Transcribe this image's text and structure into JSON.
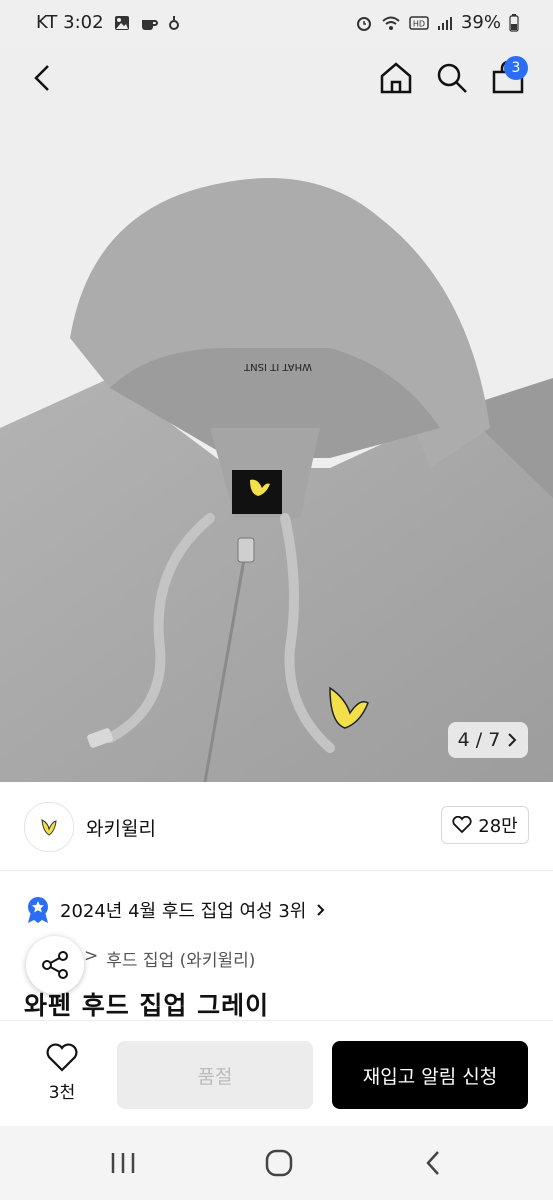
{
  "status_bar": {
    "carrier_time": "KT 3:02",
    "battery": "39%"
  },
  "header": {
    "cart_count": "3"
  },
  "gallery": {
    "counter": "4 / 7"
  },
  "brand": {
    "name": "와키윌리",
    "likes": "28만"
  },
  "ranking": {
    "text": "2024년 4월 후드 집업 여성 3위"
  },
  "breadcrumb": {
    "category": "후드 집업 (와키윌리)"
  },
  "product": {
    "title": "와펜 후드 집업 그레이",
    "hood_print": "WHAT IT ISNT"
  },
  "bottom_bar": {
    "wish_count": "3천",
    "soldout_label": "품절",
    "restock_label": "재입고 알림 신청"
  },
  "colors": {
    "accent": "#2b6ef3",
    "hoodie": "#a9a9a9",
    "duck": "#f2e04a"
  }
}
